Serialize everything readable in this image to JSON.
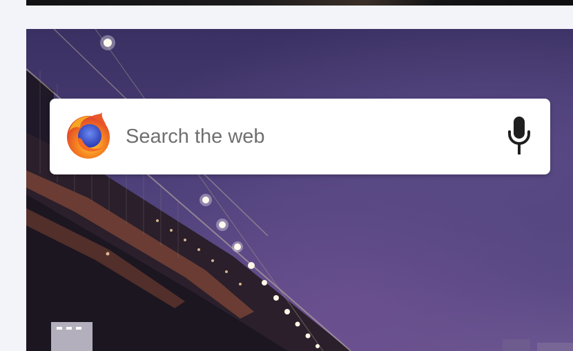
{
  "search": {
    "placeholder": "Search the web"
  },
  "icons": {
    "browser_logo": "firefox-logo",
    "voice": "microphone-icon"
  },
  "colors": {
    "widget_bg": "#ffffff",
    "placeholder_text": "#6f6f6f",
    "mic_icon": "#1f1f1f",
    "logo_orange": "#f37a22",
    "logo_blue": "#3a4fd0",
    "page_bg": "#f2f4fa",
    "sky": "#4c3f78"
  }
}
